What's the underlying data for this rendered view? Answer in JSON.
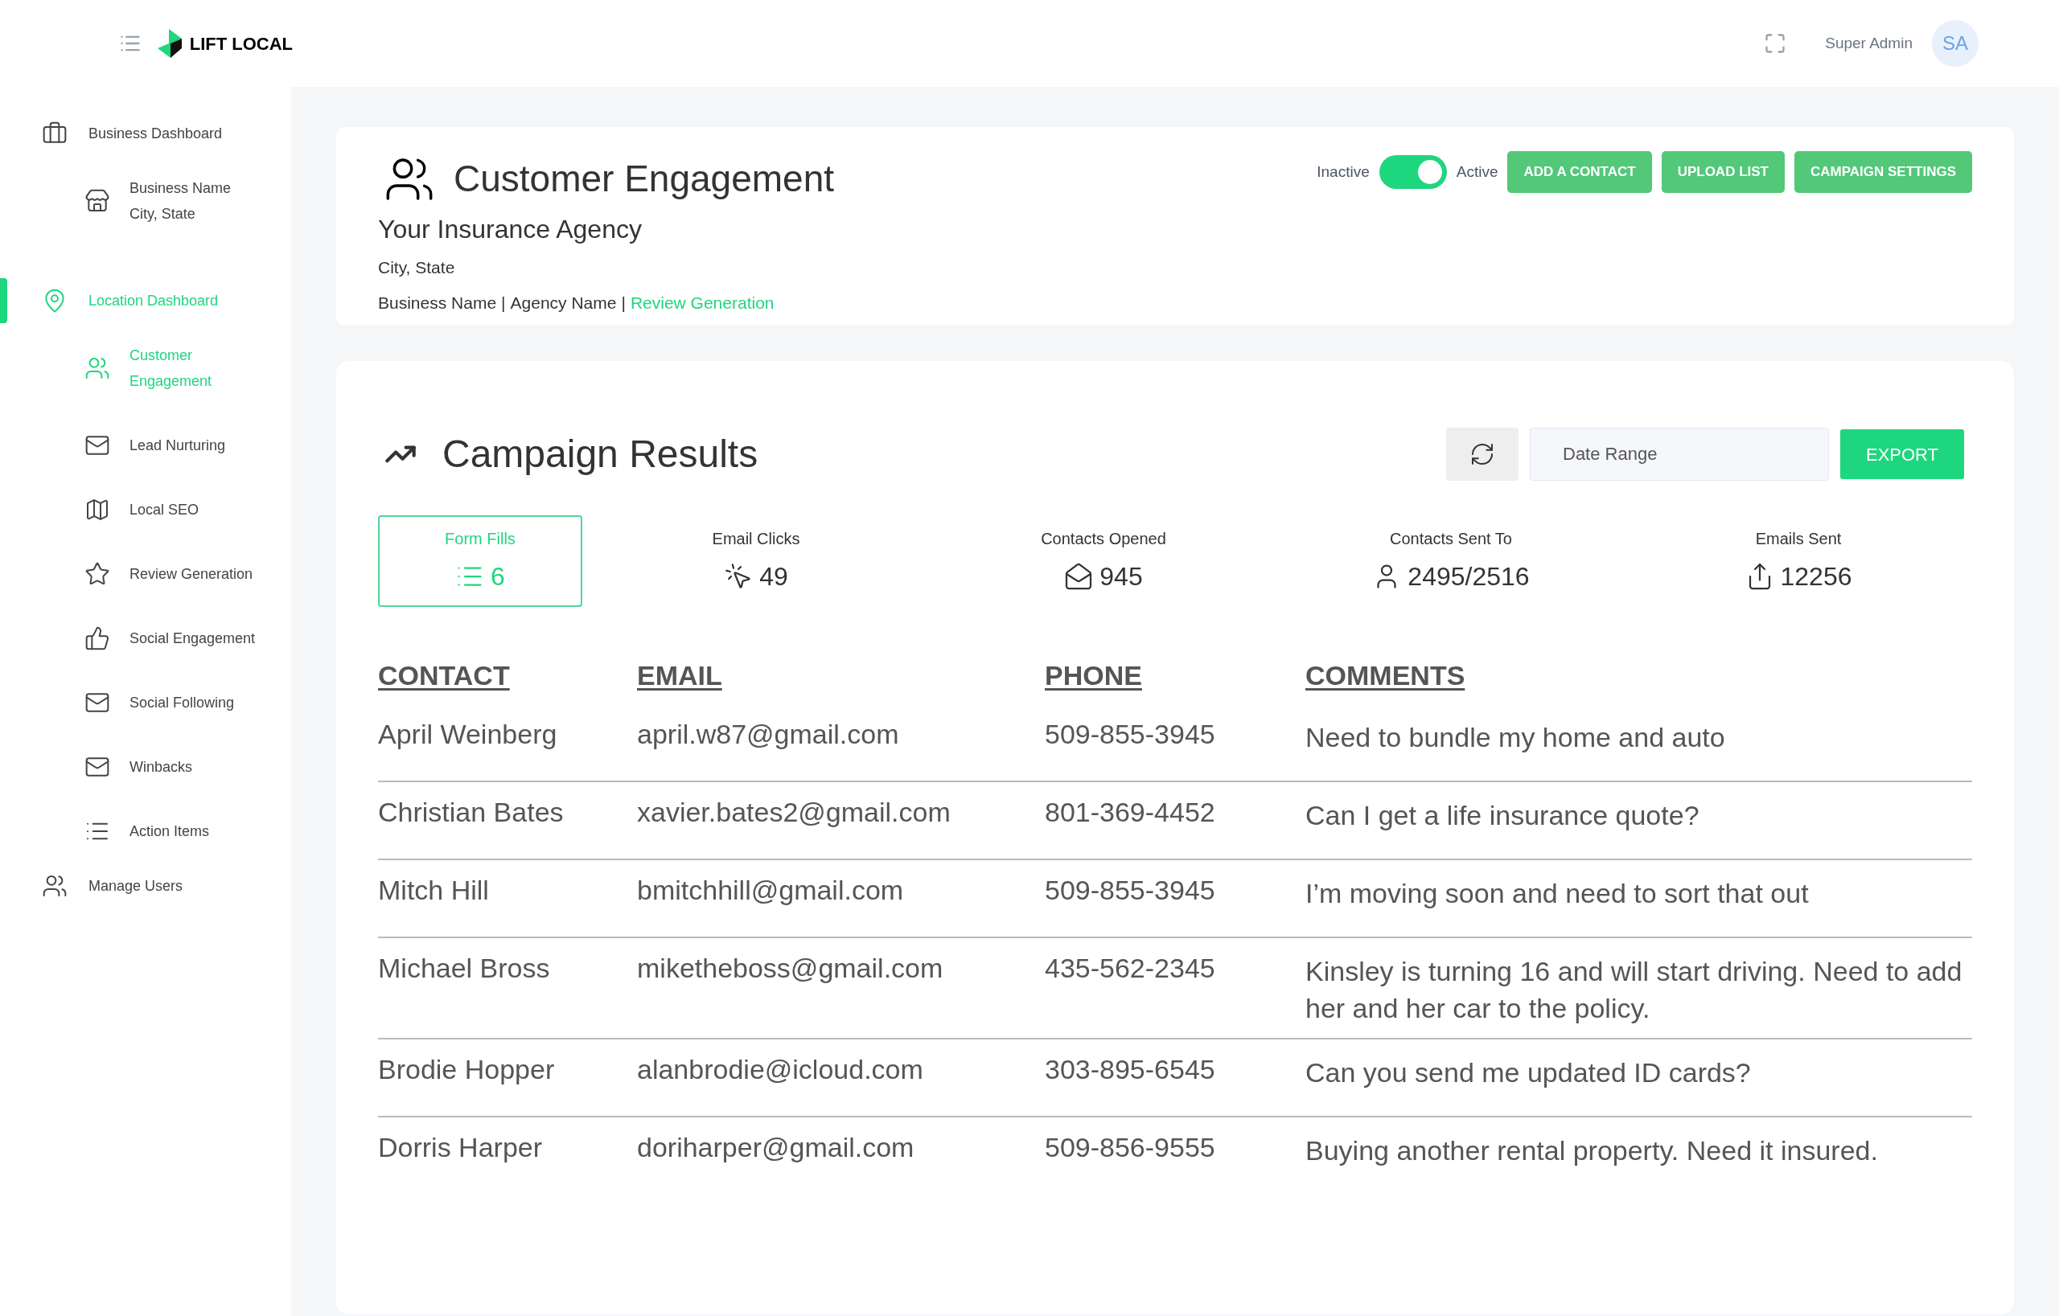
{
  "topbar": {
    "logo_text": "LIFT LOCAL",
    "user_name": "Super Admin",
    "avatar_initials": "SA"
  },
  "sidebar": {
    "items": [
      {
        "label": "Business Dashboard",
        "selected": false,
        "children": [
          {
            "label": "Business Name",
            "sublabel": "City, State",
            "selected": false
          }
        ]
      },
      {
        "label": "Location Dashboard",
        "selected": true,
        "children": [
          {
            "label": "Customer Engagement",
            "selected": true
          },
          {
            "label": "Lead Nurturing",
            "selected": false
          },
          {
            "label": "Local SEO",
            "selected": false
          },
          {
            "label": "Review Generation",
            "selected": false
          },
          {
            "label": "Social Engagement",
            "selected": false
          },
          {
            "label": "Social Following",
            "selected": false
          },
          {
            "label": "Winbacks",
            "selected": false
          },
          {
            "label": "Action Items",
            "selected": false
          }
        ]
      },
      {
        "label": "Manage Users",
        "selected": false
      }
    ]
  },
  "header": {
    "title": "Customer Engagement",
    "agency": "Your Insurance Agency",
    "location": "City, State",
    "breadcrumb": [
      "Business Name",
      "Agency Name"
    ],
    "breadcrumb_separator": "|",
    "breadcrumb_link": "Review Generation",
    "toggle": {
      "off_label": "Inactive",
      "on_label": "Active",
      "on": true
    },
    "buttons": [
      "ADD A CONTACT",
      "UPLOAD LIST",
      "CAMPAIGN SETTINGS"
    ]
  },
  "results": {
    "title": "Campaign Results",
    "date_range": {
      "placeholder": "Date Range"
    },
    "export_button": "EXPORT",
    "stats": [
      {
        "label": "Form Fills",
        "value": "6",
        "selected": true
      },
      {
        "label": "Email Clicks",
        "value": "49",
        "selected": false
      },
      {
        "label": "Contacts Opened",
        "value": "945",
        "selected": false
      },
      {
        "label": "Contacts Sent To",
        "value": "2495/2516",
        "selected": false
      },
      {
        "label": "Emails Sent",
        "value": "12256",
        "selected": false
      }
    ],
    "table": {
      "columns": [
        "CONTACT",
        "EMAIL",
        "PHONE",
        "COMMENTS"
      ],
      "rows": [
        [
          "April Weinberg",
          "april.w87@gmail.com",
          "509-855-3945",
          "Need to bundle my home and auto"
        ],
        [
          "Christian Bates",
          "xavier.bates2@gmail.com",
          "801-369-4452",
          "Can I get a life insurance quote?"
        ],
        [
          "Mitch Hill",
          "bmitchhill@gmail.com",
          "509-855-3945",
          "I’m moving soon and need to sort that out"
        ],
        [
          "Michael Bross",
          "miketheboss@gmail.com",
          "435-562-2345",
          "Kinsley is turning 16 and will start driving. Need to add her and her car to the policy."
        ],
        [
          "Brodie Hopper",
          "alanbrodie@icloud.com",
          "303-895-6545",
          "Can you send me updated ID cards?"
        ],
        [
          "Dorris Harper",
          "doriharper@gmail.com",
          "509-856-9555",
          "Buying another rental property. Need it insured."
        ]
      ]
    }
  }
}
